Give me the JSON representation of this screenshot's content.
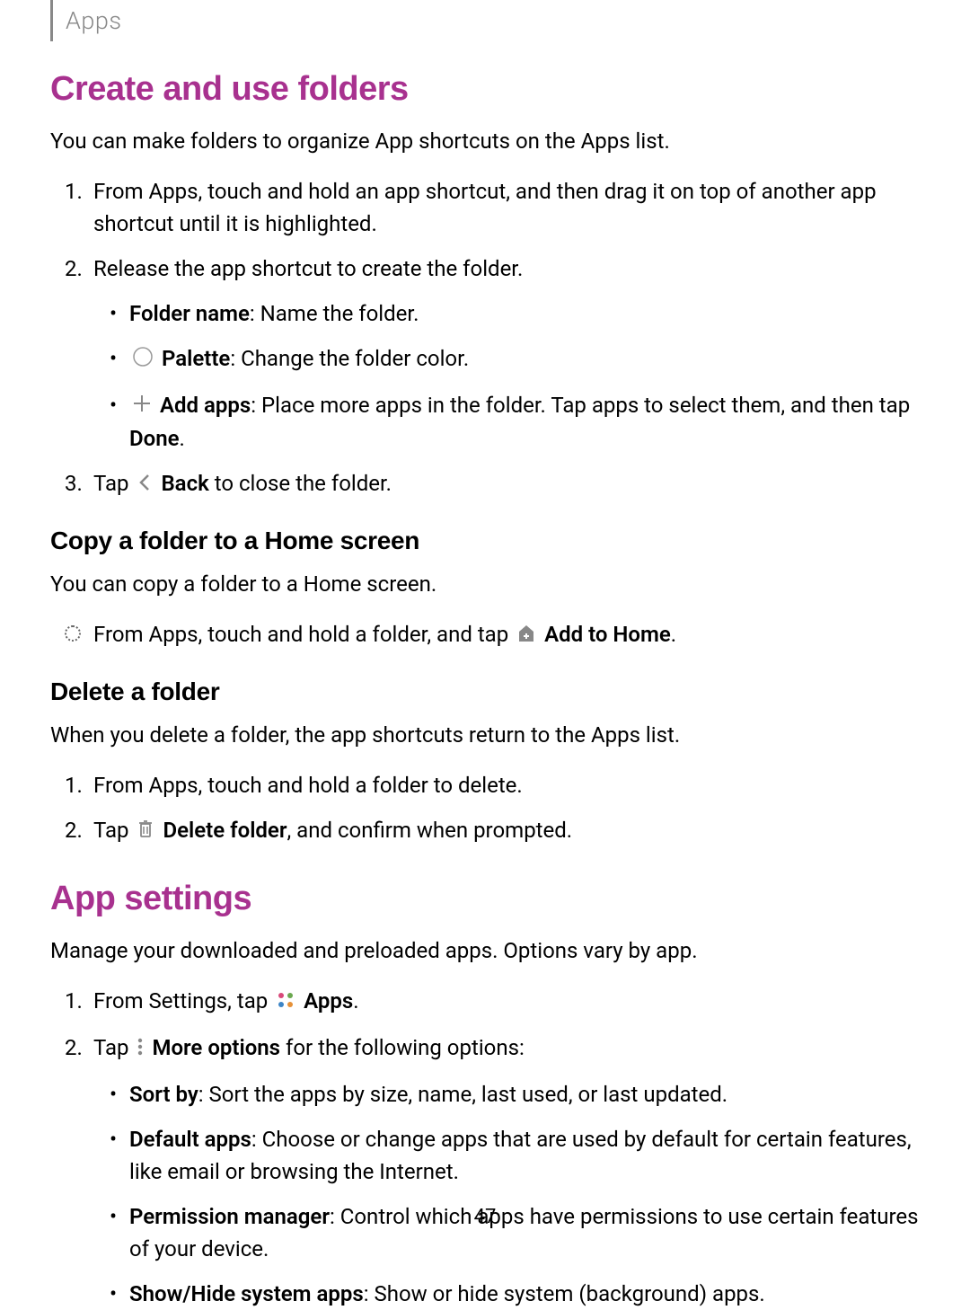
{
  "header": {
    "breadcrumb": "Apps"
  },
  "section1": {
    "title": "Create and use folders",
    "intro": "You can make folders to organize App shortcuts on the Apps list.",
    "step1": "From Apps, touch and hold an app shortcut, and then drag it on top of another app shortcut until it is highlighted.",
    "step2": "Release the app shortcut to create the folder.",
    "sub_a_bold": "Folder name",
    "sub_a_text": ": Name the folder.",
    "sub_b_bold": "Palette",
    "sub_b_text": ": Change the folder color.",
    "sub_c_bold": "Add apps",
    "sub_c_text": ": Place more apps in the folder. Tap apps to select them, and then tap ",
    "sub_c_done": "Done",
    "sub_c_end": ".",
    "step3_pre": "Tap ",
    "step3_bold": "Back",
    "step3_post": " to close the folder."
  },
  "section2": {
    "title": "Copy a folder to a Home screen",
    "intro": "You can copy a folder to a Home screen.",
    "bullet_pre": "From Apps, touch and hold a folder, and tap ",
    "bullet_bold": "Add to Home",
    "bullet_end": "."
  },
  "section3": {
    "title": "Delete a folder",
    "intro": "When you delete a folder, the app shortcuts return to the Apps list.",
    "step1": "From Apps, touch and hold a folder to delete.",
    "step2_pre": "Tap ",
    "step2_bold": "Delete folder",
    "step2_post": ", and confirm when prompted."
  },
  "section4": {
    "title": "App settings",
    "intro": "Manage your downloaded and preloaded apps. Options vary by app.",
    "step1_pre": "From Settings, tap ",
    "step1_bold": "Apps",
    "step1_end": ".",
    "step2_pre": "Tap ",
    "step2_bold": "More options",
    "step2_post": " for the following options:",
    "sub_a_bold": "Sort by",
    "sub_a_text": ": Sort the apps by size, name, last used, or last updated.",
    "sub_b_bold": "Default apps",
    "sub_b_text": ": Choose or change apps that are used by default for certain features, like email or browsing the Internet.",
    "sub_c_bold": "Permission manager",
    "sub_c_text": ": Control which apps have permissions to use certain features of your device.",
    "sub_d_bold": "Show/Hide system apps",
    "sub_d_text": ": Show or hide system (background) apps."
  },
  "page_number": "47"
}
